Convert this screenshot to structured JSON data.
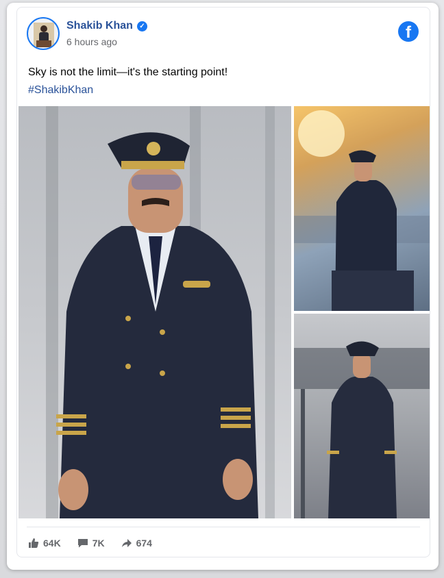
{
  "post": {
    "author_name": "Shakib Khan",
    "timestamp": "6 hours ago",
    "caption": "Sky is not the limit—it's the starting point!",
    "hashtag": "#ShakibKhan",
    "verified_icon": "check-badge-icon",
    "platform_icon": "facebook-icon"
  },
  "photos": [
    {
      "description_icon": "pilot-portrait-photo"
    },
    {
      "description_icon": "pilot-seated-photo"
    },
    {
      "description_icon": "pilot-standing-photo"
    }
  ],
  "reactions": {
    "likes": "64K",
    "comments": "7K",
    "shares": "674"
  },
  "colors": {
    "brand": "#1877f2",
    "name": "#2a5299",
    "muted": "#65676b"
  }
}
